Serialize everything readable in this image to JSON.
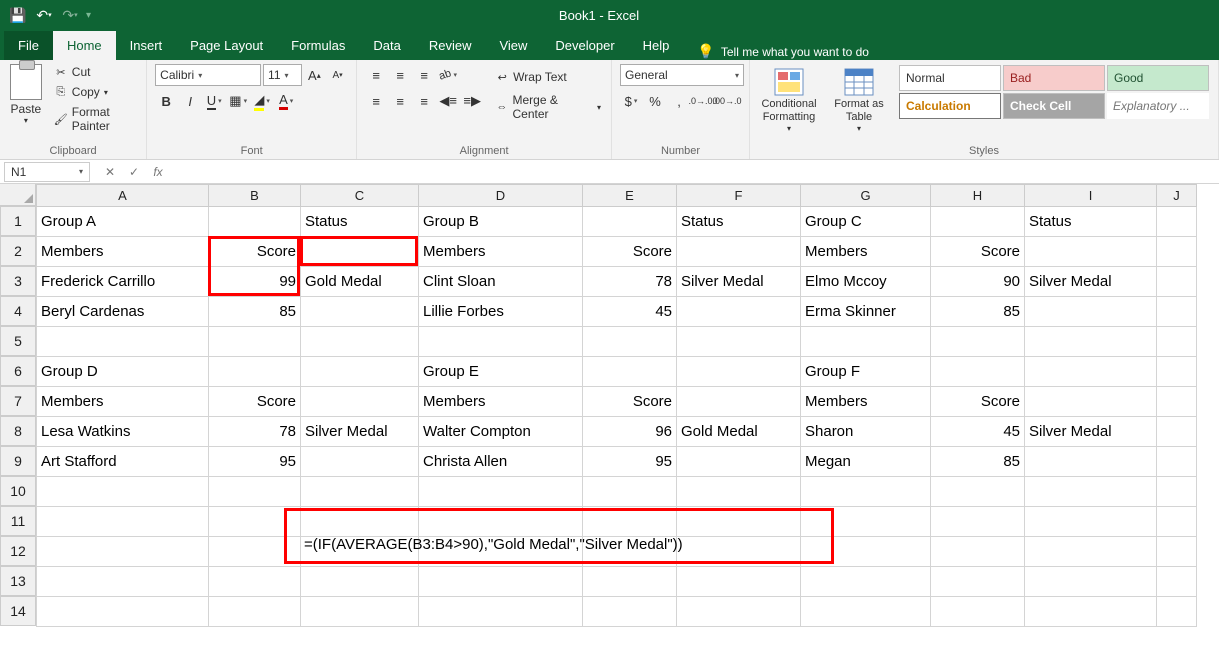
{
  "window": {
    "title": "Book1  -  Excel"
  },
  "tabs": {
    "file": "File",
    "home": "Home",
    "insert": "Insert",
    "pagelayout": "Page Layout",
    "formulas": "Formulas",
    "data": "Data",
    "review": "Review",
    "view": "View",
    "developer": "Developer",
    "help": "Help",
    "tellme": "Tell me what you want to do"
  },
  "ribbon": {
    "clipboard": {
      "paste": "Paste",
      "cut": "Cut",
      "copy": "Copy",
      "formatpainter": "Format Painter",
      "label": "Clipboard"
    },
    "font": {
      "name": "Calibri",
      "size": "11",
      "label": "Font"
    },
    "alignment": {
      "wrap": "Wrap Text",
      "merge": "Merge & Center",
      "label": "Alignment"
    },
    "number": {
      "format": "General",
      "label": "Number"
    },
    "styles": {
      "conditional": "Conditional Formatting",
      "formatas": "Format as Table",
      "normal": "Normal",
      "bad": "Bad",
      "good": "Good",
      "calculation": "Calculation",
      "checkcell": "Check Cell",
      "explanatory": "Explanatory ...",
      "label": "Styles"
    }
  },
  "namebox": "N1",
  "cells": {
    "A1": "Group A",
    "C1": "Status",
    "D1": "Group B",
    "F1": "Status",
    "G1": "Group C",
    "I1": "Status",
    "A2": "Members",
    "B2": "Score",
    "D2": "Members",
    "E2": "Score",
    "G2": "Members",
    "H2": "Score",
    "A3": "Frederick Carrillo",
    "B3": "99",
    "C3": "Gold Medal",
    "D3": "Clint Sloan",
    "E3": "78",
    "F3": "Silver Medal",
    "G3": "Elmo Mccoy",
    "H3": "90",
    "I3": "Silver Medal",
    "A4": "Beryl Cardenas",
    "B4": "85",
    "D4": "Lillie Forbes",
    "E4": "45",
    "G4": "Erma Skinner",
    "H4": "85",
    "A6": "Group D",
    "D6": "Group E",
    "G6": "Group F",
    "A7": "Members",
    "B7": "Score",
    "D7": "Members",
    "E7": "Score",
    "G7": "Members",
    "H7": "Score",
    "A8": "Lesa Watkins",
    "B8": "78",
    "C8": "Silver Medal",
    "D8": "Walter Compton",
    "E8": "96",
    "F8": "Gold Medal",
    "G8": "Sharon",
    "H8": "45",
    "I8": "Silver Medal",
    "A9": "Art Stafford",
    "B9": "95",
    "D9": "Christa Allen",
    "E9": "95",
    "G9": "Megan",
    "H9": "85"
  },
  "formula_annotation": "=(IF(AVERAGE(B3:B4>90),\"Gold Medal\",\"Silver Medal\"))"
}
